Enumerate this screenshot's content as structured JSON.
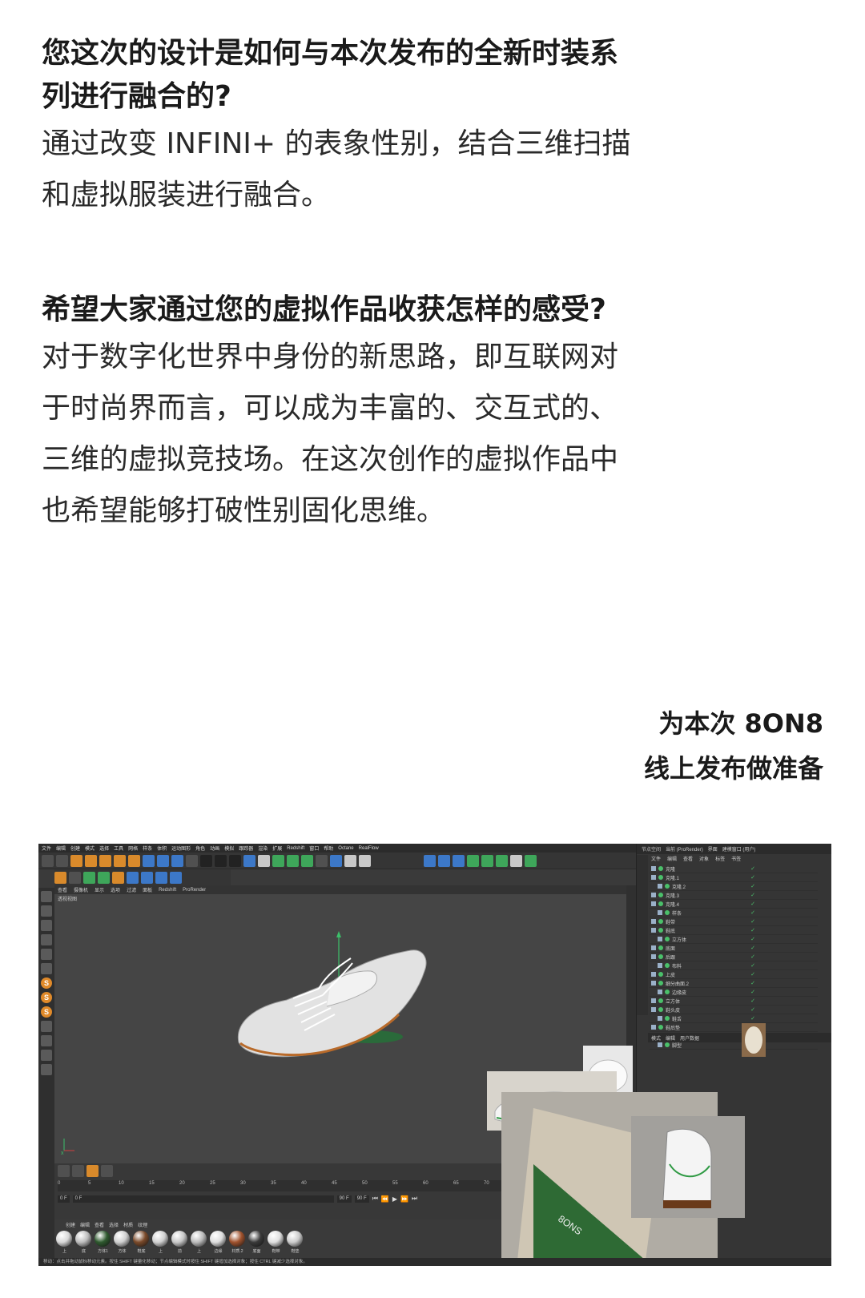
{
  "qa": [
    {
      "question_lines": [
        "您这次的设计是如何与本次发布的全新时装系",
        "列进行融合的?"
      ],
      "answer_lines": [
        "通过改变 INFINI+ 的表象性别，结合三维扫描",
        "和虚拟服装进行融合。"
      ]
    },
    {
      "question_lines": [
        "希望大家通过您的虚拟作品收获怎样的感受?"
      ],
      "answer_lines": [
        "对于数字化世界中身份的新思路，即互联网对",
        "于时尚界而言，可以成为丰富的、交互式的、",
        "三维的虚拟竞技场。在这次创作的虚拟作品中",
        "也希望能够打破性别固化思维。"
      ]
    }
  ],
  "caption": {
    "lines": [
      "为本次 8ON8",
      "线上发布做准备"
    ]
  },
  "c4d": {
    "menu": [
      "文件",
      "编辑",
      "创建",
      "模式",
      "选择",
      "工具",
      "网格",
      "样条",
      "体积",
      "运动图形",
      "角色",
      "动画",
      "模拟",
      "跟踪器",
      "渲染",
      "扩展",
      "Redshift",
      "窗口",
      "帮助",
      "Octane",
      "RealFlow"
    ],
    "view_menu": [
      "查看",
      "摄像机",
      "显示",
      "选项",
      "过滤",
      "面板",
      "Redshift",
      "ProRender"
    ],
    "viewport_label": "透视视图",
    "right_top": [
      "节点空间",
      "当前 (ProRender)",
      "界面",
      "建模窗口 (用户)"
    ],
    "obj_menu": [
      "文件",
      "编辑",
      "查看",
      "对象",
      "标签",
      "书签"
    ],
    "objects": [
      "克隆",
      "克隆.1",
      "克隆.2",
      "克隆.3",
      "克隆.4",
      "样条",
      "鞋带",
      "鞋底",
      "立方体",
      "底面",
      "后跟",
      "布料",
      "上皮",
      "细分曲面.2",
      "边缘皮",
      "立方体",
      "鞋头皮",
      "鞋舌",
      "鞋后垫",
      "鞋垫",
      "脚型"
    ],
    "attr_menu": [
      "模式",
      "编辑",
      "用户数据"
    ],
    "ruler": [
      "0",
      "5",
      "10",
      "15",
      "20",
      "25",
      "30",
      "35",
      "40",
      "45",
      "50",
      "55",
      "60",
      "65",
      "70"
    ],
    "frames": [
      "0 F",
      "0 F",
      "90 F",
      "90 F"
    ],
    "mat_menu": [
      "创建",
      "编辑",
      "查看",
      "选择",
      "材质",
      "纹理"
    ],
    "materials": [
      {
        "label": "上",
        "color": "#d8d8d8"
      },
      {
        "label": "底",
        "color": "#bdbdbd"
      },
      {
        "label": "方体1",
        "color": "#2f5a2f"
      },
      {
        "label": "方体",
        "color": "#cfcfcf"
      },
      {
        "label": "鞋底",
        "color": "#7a4a2a"
      },
      {
        "label": "上",
        "color": "#d0d0d0"
      },
      {
        "label": "前",
        "color": "#c8c8c8"
      },
      {
        "label": "上",
        "color": "#bbbbbb"
      },
      {
        "label": "边缘",
        "color": "#dddddd"
      },
      {
        "label": "材质.2",
        "color": "#a0522d"
      },
      {
        "label": "底面",
        "color": "#3a3a3a"
      },
      {
        "label": "鞋带",
        "color": "#e0e0e0"
      },
      {
        "label": "鞋垫",
        "color": "#cccccc"
      }
    ],
    "status": "移动：点击并拖动鼠标移动元素。按住 SHIFT 键量化移动；节点编辑模式时按住 SHIFT 键增加选择对象；按住 CTRL 键减少选择对象。"
  }
}
